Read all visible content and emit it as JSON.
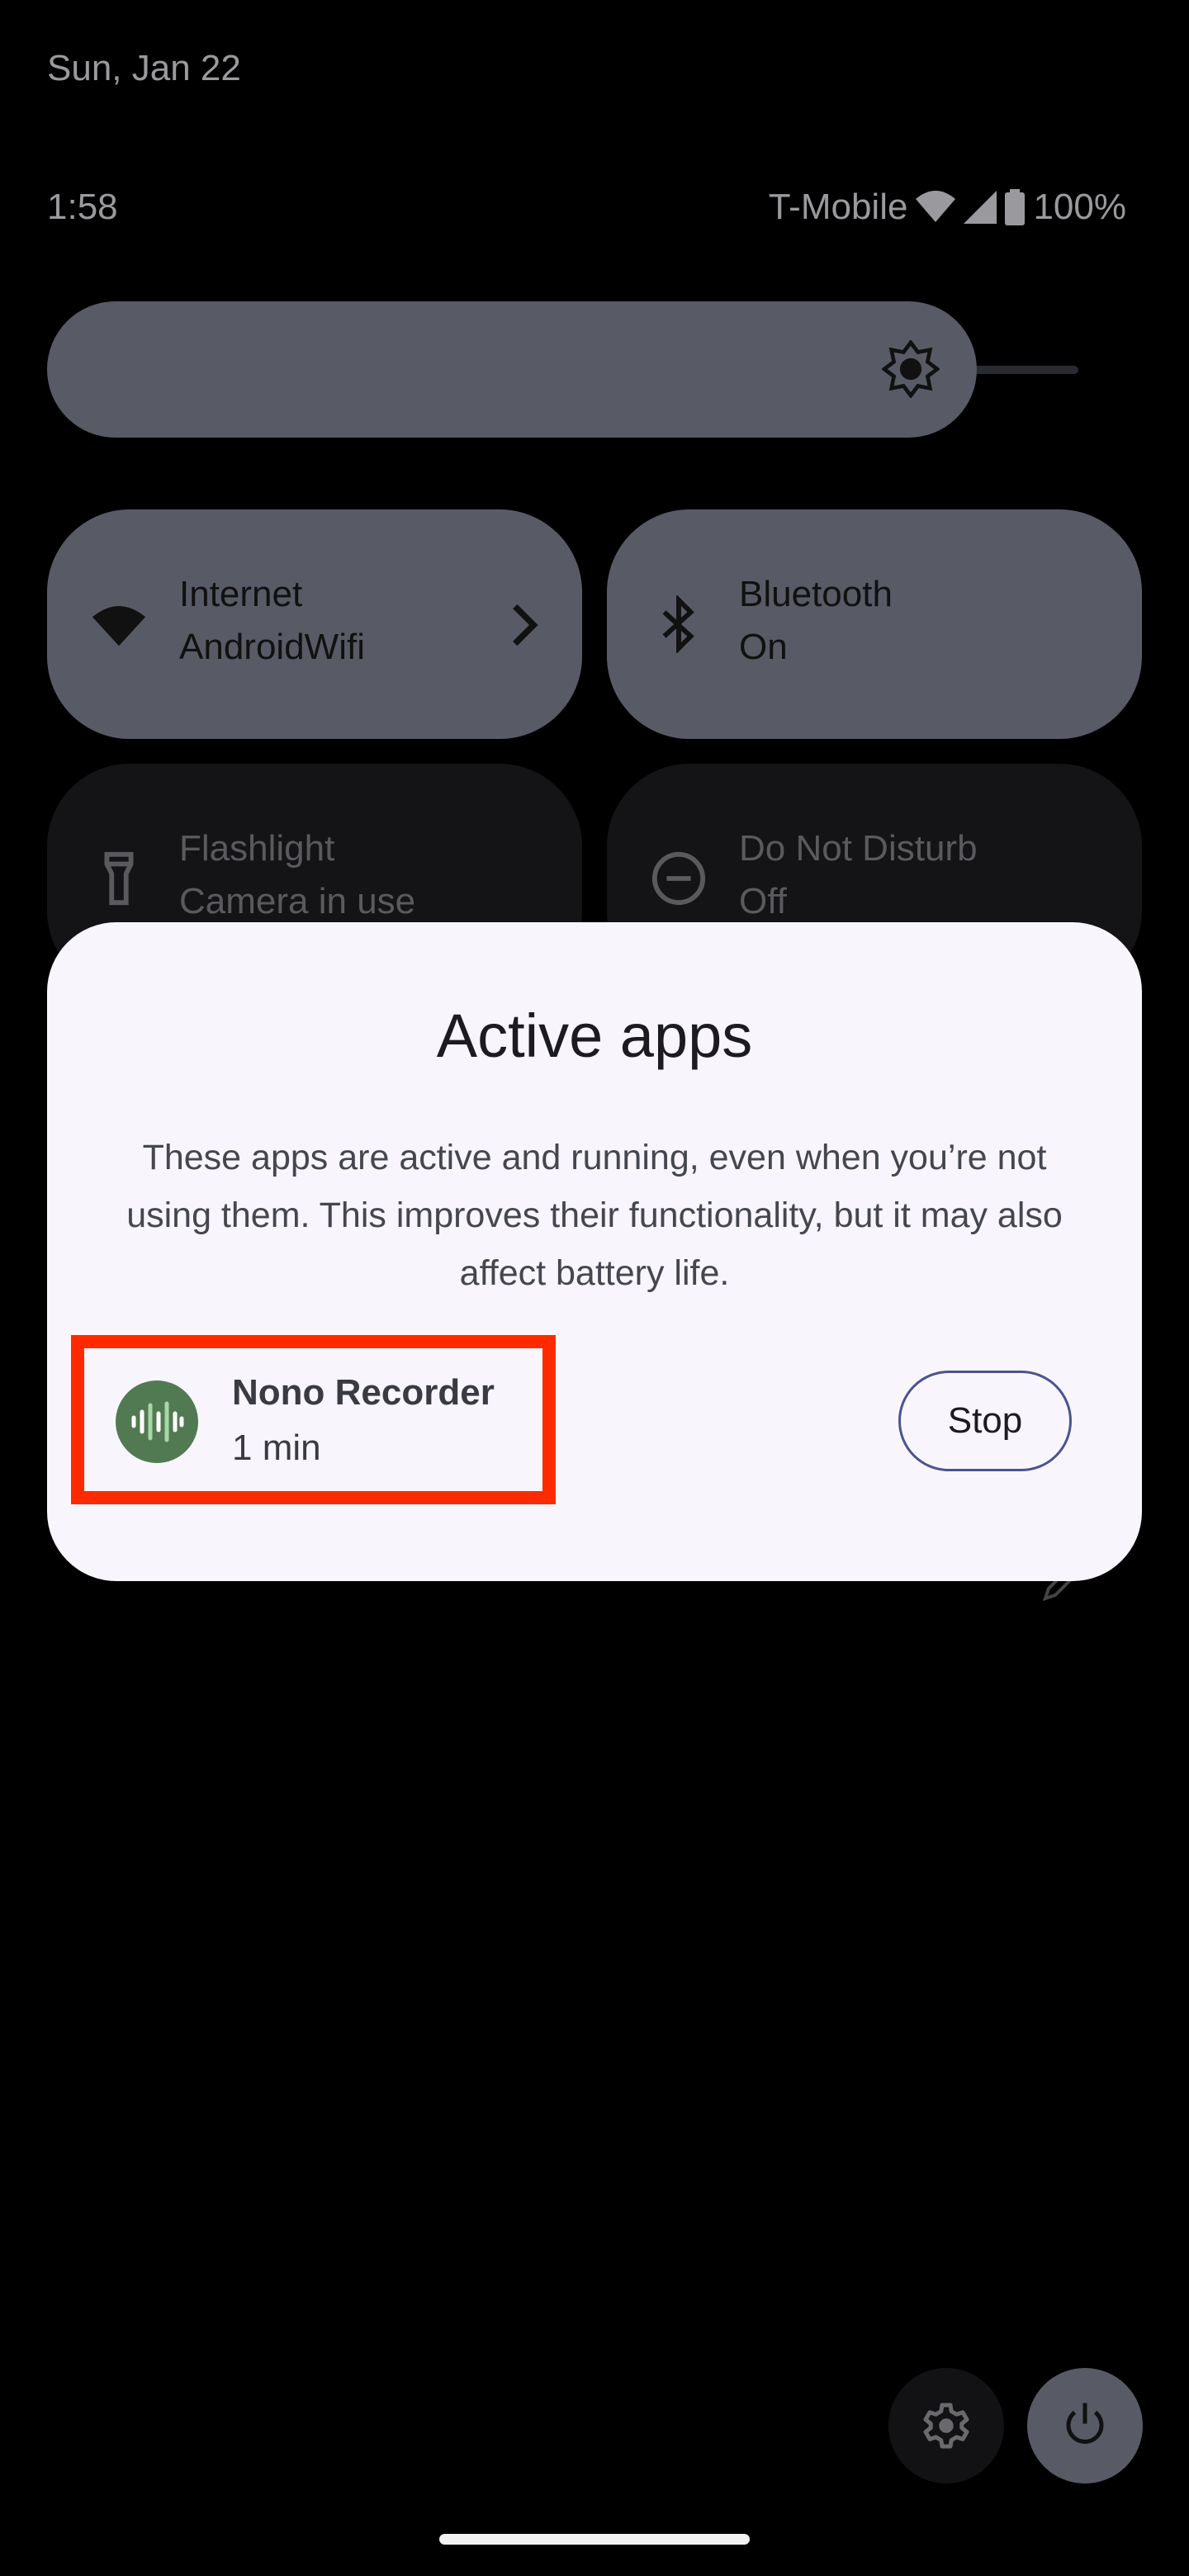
{
  "header": {
    "date": "Sun, Jan 22",
    "time": "1:58",
    "carrier": "T-Mobile",
    "battery": "100%"
  },
  "brightness": {
    "icon": "brightness-icon",
    "level_percent": 90
  },
  "tiles": [
    {
      "title": "Internet",
      "subtitle": "AndroidWifi",
      "icon": "wifi-icon",
      "state": "on"
    },
    {
      "title": "Bluetooth",
      "subtitle": "On",
      "icon": "bluetooth-icon",
      "state": "on"
    },
    {
      "title": "Flashlight",
      "subtitle": "Camera in use",
      "icon": "flashlight-icon",
      "state": "unavailable"
    },
    {
      "title": "Do Not Disturb",
      "subtitle": "Off",
      "icon": "dnd-icon",
      "state": "off"
    }
  ],
  "dialog": {
    "title": "Active apps",
    "body": "These apps are active and running, even when you’re not using them. This improves their functionality, but it may also affect battery life.",
    "apps": [
      {
        "name": "Nono Recorder",
        "duration": "1 min",
        "stop_label": "Stop"
      }
    ]
  },
  "colors": {
    "tile_on": "#585a66",
    "dialog_bg": "#f8f6fc",
    "highlight": "#ff2a00",
    "app_icon": "#527a52"
  }
}
